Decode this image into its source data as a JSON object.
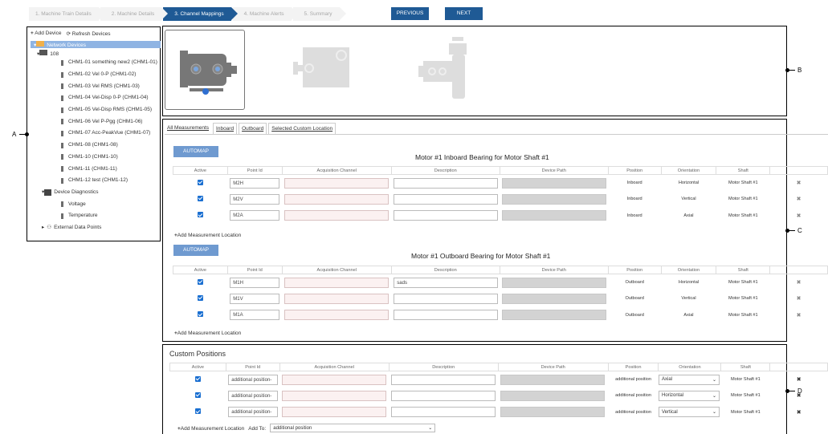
{
  "wizard": {
    "steps": [
      "1. Machine Train Details",
      "2. Machine Details",
      "3. Channel Mappings",
      "4. Machine Alerts",
      "5. Summary"
    ],
    "previous": "PREVIOUS",
    "next": "NEXT"
  },
  "callouts": {
    "a": "A",
    "b": "B",
    "c": "C",
    "d": "D"
  },
  "tree": {
    "add_device": "Add Device",
    "refresh": "Refresh Devices",
    "network_devices": "Network Devices",
    "device": "108",
    "channels": [
      "CHM1-01 something new2 (CHM1-01)",
      "CHM1-02 Vel 0-P (CHM1-02)",
      "CHM1-03 Vel RMS (CHM1-03)",
      "CHM1-04 Vel-Disp 0-P (CHM1-04)",
      "CHM1-05 Vel-Disp RMS (CHM1-05)",
      "CHM1-06 Vel P-Pgg (CHM1-06)",
      "CHM1-07 Acc-PeakVue (CHM1-07)",
      "CHM1-08 (CHM1-08)",
      "CHM1-10 (CHM1-10)",
      "CHM1-11 (CHM1-11)",
      "CHM1-12 test (CHM1-12)"
    ],
    "diagnostics": "Device Diagnostics",
    "diag_items": [
      "Voltage",
      "Temperature"
    ],
    "external": "External Data Points"
  },
  "tabs": [
    "All Measurements",
    "Inboard",
    "Outboard",
    "Selected Custom Location"
  ],
  "headers": [
    "Active",
    "Point Id",
    "Acquisition Channel",
    "Description",
    "Device Path",
    "Position",
    "Orientation",
    "Shaft"
  ],
  "automap": "AUTOMAP",
  "add_location": "Add Measurement Location",
  "inboard": {
    "title": "Motor #1 Inboard Bearing for Motor Shaft #1",
    "rows": [
      {
        "point": "M2H",
        "desc": "",
        "position": "Inboard",
        "orientation": "Horizontal",
        "shaft": "Motor Shaft #1"
      },
      {
        "point": "M2V",
        "desc": "",
        "position": "Inboard",
        "orientation": "Vertical",
        "shaft": "Motor Shaft #1"
      },
      {
        "point": "M2A",
        "desc": "",
        "position": "Inboard",
        "orientation": "Axial",
        "shaft": "Motor Shaft #1"
      }
    ]
  },
  "outboard": {
    "title": "Motor #1 Outboard Bearing for Motor Shaft #1",
    "rows": [
      {
        "point": "M1H",
        "desc": "sads",
        "position": "Outboard",
        "orientation": "Horizontal",
        "shaft": "Motor Shaft #1"
      },
      {
        "point": "M1V",
        "desc": "",
        "position": "Outboard",
        "orientation": "Vertical",
        "shaft": "Motor Shaft #1"
      },
      {
        "point": "M1A",
        "desc": "",
        "position": "Outboard",
        "orientation": "Axial",
        "shaft": "Motor Shaft #1"
      }
    ]
  },
  "custom": {
    "title": "Custom Positions",
    "rows": [
      {
        "point": "additional position-",
        "position": "additional position",
        "orientation": "Axial",
        "shaft": "Motor Shaft #1"
      },
      {
        "point": "additional position-",
        "position": "additional position",
        "orientation": "Horizontal",
        "shaft": "Motor Shaft #1"
      },
      {
        "point": "additional position-",
        "position": "additional position",
        "orientation": "Vertical",
        "shaft": "Motor Shaft #1"
      }
    ],
    "add_to_label": "Add To:",
    "add_to_value": "additional position"
  }
}
